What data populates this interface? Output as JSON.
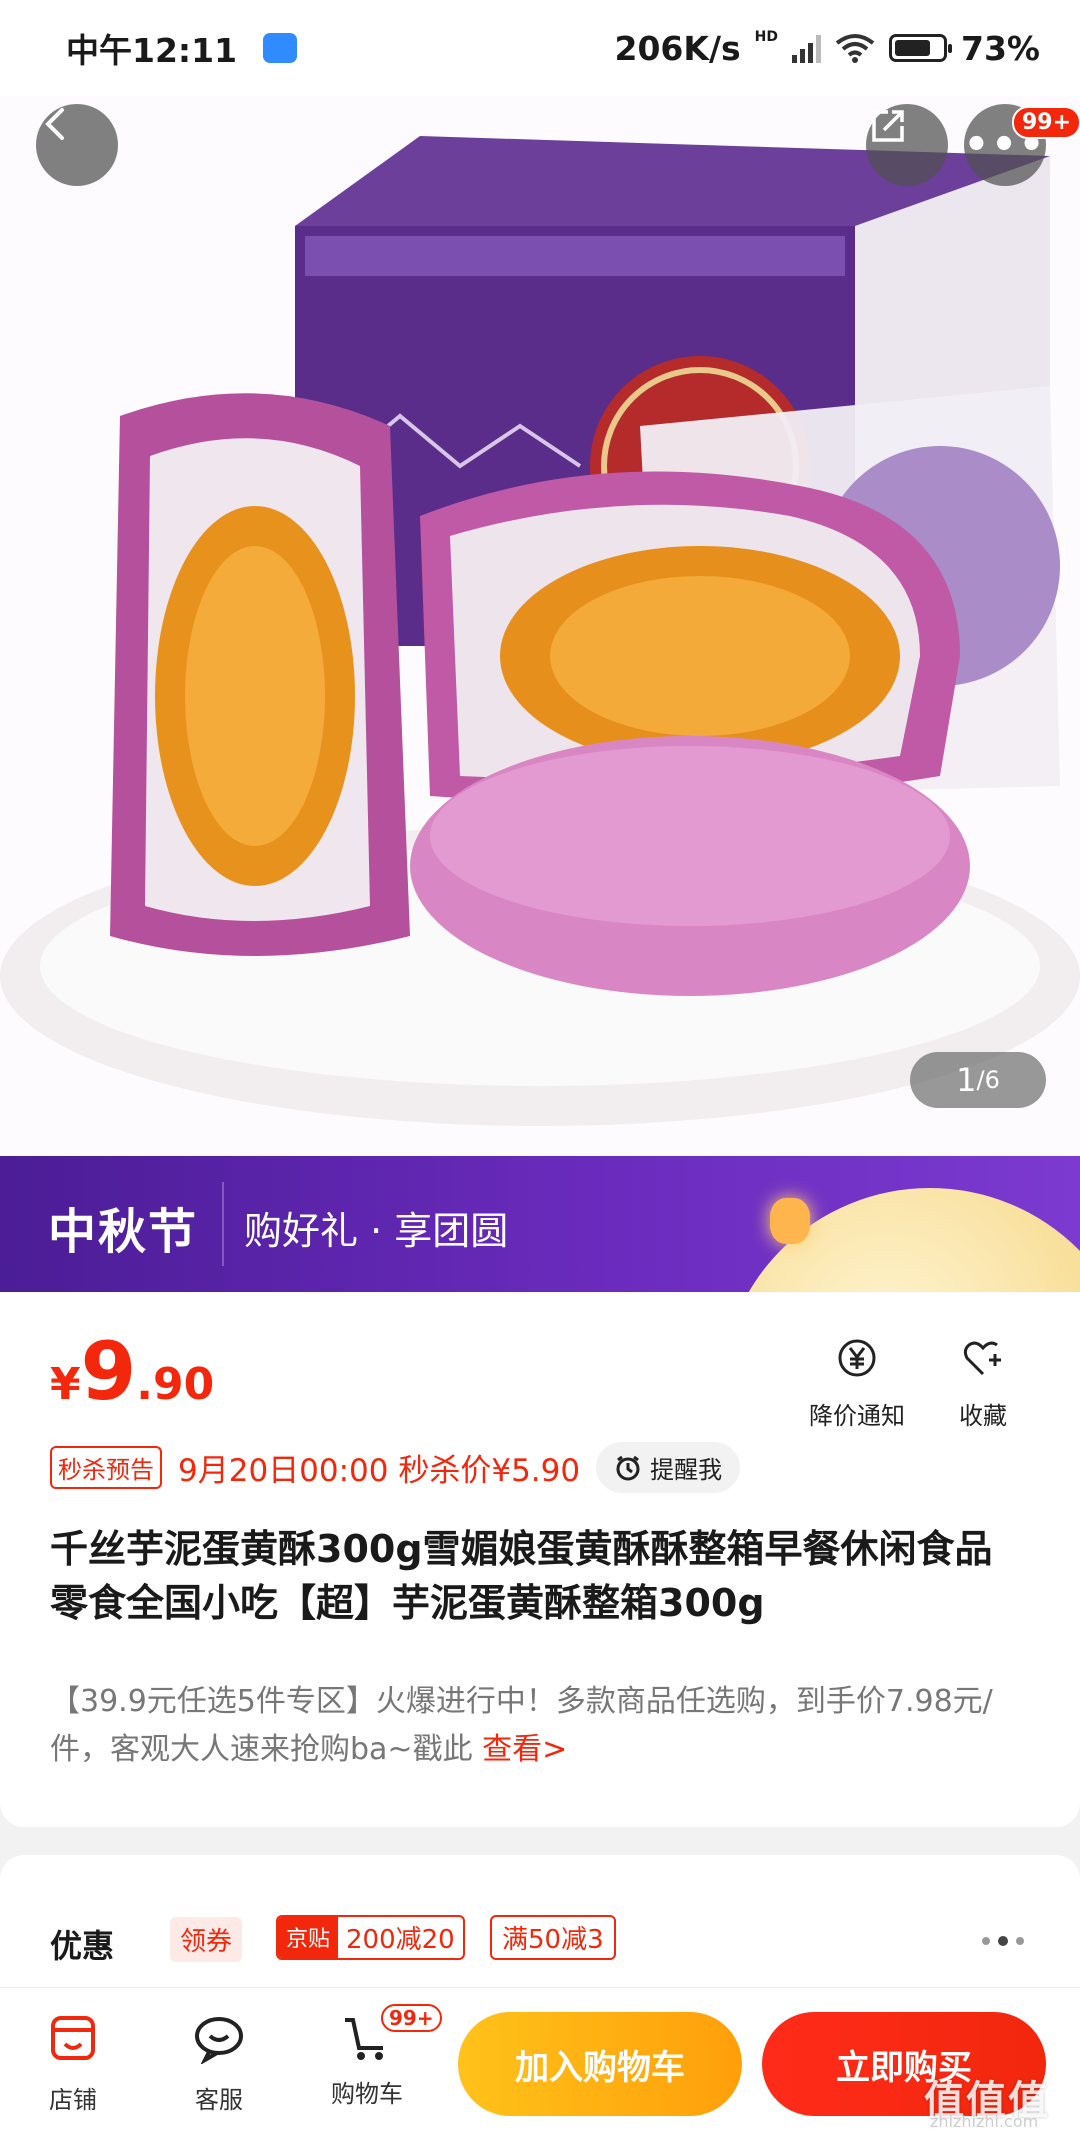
{
  "status_bar": {
    "time": "中午12:11",
    "speed": "206K/s",
    "network": "HD",
    "battery": "73%"
  },
  "gallery": {
    "current": "1",
    "total": "/6",
    "more_badge": "99+"
  },
  "banner": {
    "title": "中秋节",
    "subtitle": "购好礼 · 享团圆"
  },
  "price": {
    "currency": "¥",
    "integer": "9",
    "decimal": ".90"
  },
  "actions": {
    "price_alert": "降价通知",
    "favorite": "收藏"
  },
  "flash_sale": {
    "tag": "秒杀预告",
    "text": "9月20日00:00 秒杀价¥5.90",
    "remind": "提醒我"
  },
  "product": {
    "title": "千丝芋泥蛋黄酥300g雪媚娘蛋黄酥酥整箱早餐休闲食品零食全国小吃【超】芋泥蛋黄酥整箱300g",
    "promo": "【39.9元任选5件专区】火爆进行中！多款商品任选购，到手价7.98元/件，客观大人速来抢购ba~戳此 ",
    "promo_link": "查看>"
  },
  "coupons": {
    "label": "优惠",
    "claim": "领券",
    "jingtie_tag": "京贴",
    "jingtie_value": "200减20",
    "full_reduce": "满50减3"
  },
  "bottom_bar": {
    "shop": "店铺",
    "service": "客服",
    "cart": "购物车",
    "cart_badge": "99+",
    "add_to_cart": "加入购物车",
    "buy_now": "立即购买"
  },
  "watermark": {
    "text": "值值值",
    "url": "zhizhizhi.com"
  },
  "colors": {
    "accent": "#f2270c",
    "cart_button": "#ffb414",
    "banner": "#5b24a8"
  }
}
